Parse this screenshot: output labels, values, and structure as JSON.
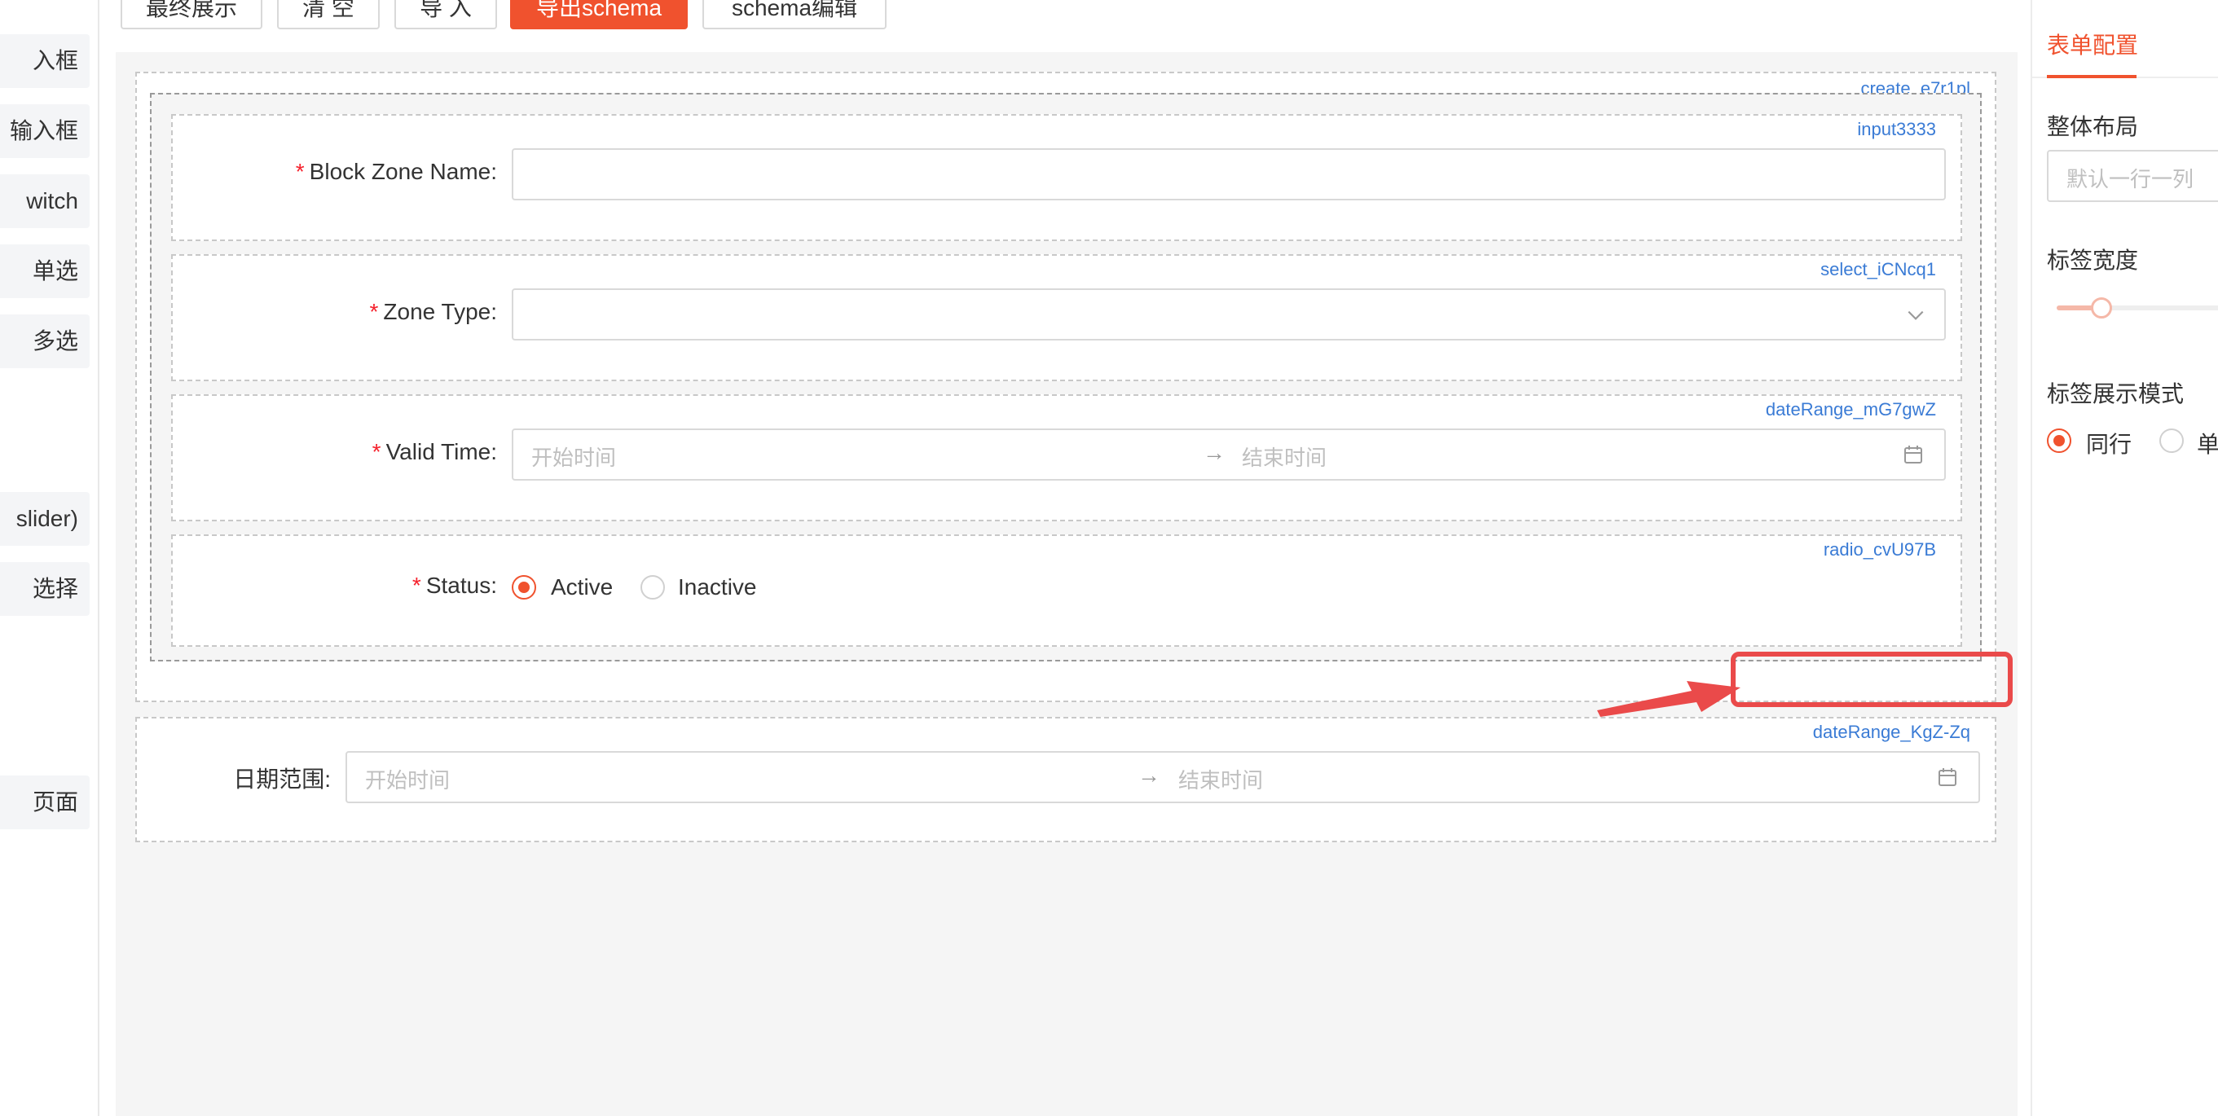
{
  "palette": {
    "items": [
      {
        "label": "入框"
      },
      {
        "label": "输入框"
      },
      {
        "label": "witch"
      },
      {
        "label": "单选"
      },
      {
        "label": "多选"
      },
      {
        "label": "slider)"
      },
      {
        "label": "选择"
      },
      {
        "label": "页面"
      }
    ]
  },
  "toolbar": {
    "buttons": [
      {
        "label": "最终展示"
      },
      {
        "label": "清 空"
      },
      {
        "label": "导 入"
      },
      {
        "label": "导出schema"
      },
      {
        "label": "schema编辑"
      }
    ]
  },
  "canvas": {
    "outer_container_id": "create_e7r1pl",
    "fields": [
      {
        "id": "input3333",
        "label": "Block Zone Name",
        "required": true,
        "type": "input",
        "value": ""
      },
      {
        "id": "select_iCNcq1",
        "label": "Zone Type",
        "required": true,
        "type": "select",
        "value": ""
      },
      {
        "id": "dateRange_mG7gwZ",
        "label": "Valid Time",
        "required": true,
        "type": "dateRange",
        "start_placeholder": "开始时间",
        "end_placeholder": "结束时间"
      },
      {
        "id": "radio_cvU97B",
        "label": "Status",
        "required": true,
        "type": "radio",
        "options": [
          "Active",
          "Inactive"
        ],
        "selected": "Active"
      }
    ],
    "standalone_field": {
      "id": "dateRange_KgZ-Zq",
      "label": "日期范围",
      "required": false,
      "type": "dateRange",
      "start_placeholder": "开始时间",
      "end_placeholder": "结束时间"
    },
    "label_colon": ":",
    "range_arrow": "→"
  },
  "right_panel": {
    "tab": "表单配置",
    "layout_label": "整体布局",
    "layout_placeholder": "默认一行一列",
    "label_width_label": "标签宽度",
    "label_width_value_fraction": 0.25,
    "label_mode_label": "标签展示模式",
    "label_mode_options": [
      "同行",
      "单"
    ],
    "label_mode_selected": "同行"
  },
  "colors": {
    "primary": "#f0522e",
    "id_text": "#3a7bd5",
    "required": "#f5222d",
    "annotation": "#ea4a4a"
  },
  "icons": {
    "calendar": "calendar-icon",
    "chevron": "chevron-down-icon",
    "arrow": "annotation-arrow-icon"
  }
}
